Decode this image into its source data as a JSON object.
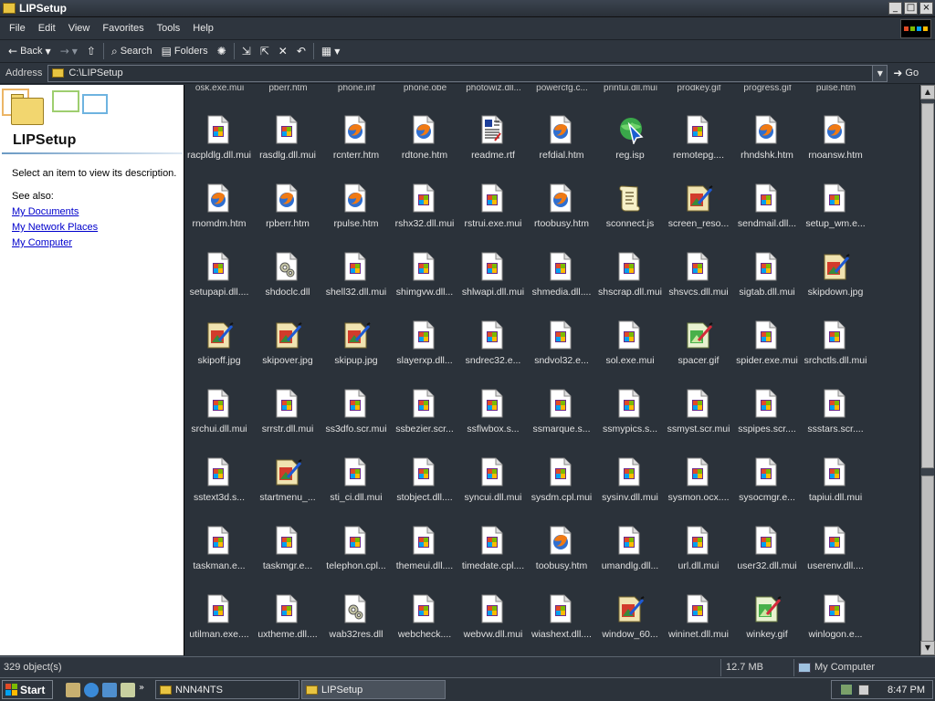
{
  "window": {
    "title": "LIPSetup"
  },
  "window_controls": {
    "minimize": "_",
    "maximize": "□",
    "close": "×"
  },
  "menu": [
    "File",
    "Edit",
    "View",
    "Favorites",
    "Tools",
    "Help"
  ],
  "toolbar": {
    "back": "Back",
    "search": "Search",
    "folders": "Folders"
  },
  "address": {
    "label": "Address",
    "path": "C:\\LIPSetup",
    "go": "Go"
  },
  "left_pane": {
    "title": "LIPSetup",
    "description": "Select an item to view its description.",
    "see_also": "See also:",
    "links": [
      "My Documents",
      "My Network Places",
      "My Computer"
    ]
  },
  "partial_row": [
    "osk.exe.mui",
    "pberr.htm",
    "phone.inf",
    "phone.obe",
    "photowiz.dll...",
    "powercfg.c...",
    "printui.dll.mui",
    "prodkey.gif",
    "progress.gif",
    "pulse.htm"
  ],
  "files": [
    {
      "name": "racpldlg.dll.mui",
      "icon": "mui"
    },
    {
      "name": "rasdlg.dll.mui",
      "icon": "mui"
    },
    {
      "name": "rcnterr.htm",
      "icon": "htm"
    },
    {
      "name": "rdtone.htm",
      "icon": "htm"
    },
    {
      "name": "readme.rtf",
      "icon": "rtf"
    },
    {
      "name": "refdial.htm",
      "icon": "htm"
    },
    {
      "name": "reg.isp",
      "icon": "isp"
    },
    {
      "name": "remotepg....",
      "icon": "mui"
    },
    {
      "name": "rhndshk.htm",
      "icon": "htm"
    },
    {
      "name": "rnoansw.htm",
      "icon": "htm"
    },
    {
      "name": "rnomdm.htm",
      "icon": "htm"
    },
    {
      "name": "rpberr.htm",
      "icon": "htm"
    },
    {
      "name": "rpulse.htm",
      "icon": "htm"
    },
    {
      "name": "rshx32.dll.mui",
      "icon": "mui"
    },
    {
      "name": "rstrui.exe.mui",
      "icon": "mui"
    },
    {
      "name": "rtoobusy.htm",
      "icon": "htm"
    },
    {
      "name": "sconnect.js",
      "icon": "js"
    },
    {
      "name": "screen_reso...",
      "icon": "jpg"
    },
    {
      "name": "sendmail.dll...",
      "icon": "mui"
    },
    {
      "name": "setup_wm.e...",
      "icon": "mui"
    },
    {
      "name": "setupapi.dll....",
      "icon": "mui"
    },
    {
      "name": "shdoclc.dll",
      "icon": "dll"
    },
    {
      "name": "shell32.dll.mui",
      "icon": "mui"
    },
    {
      "name": "shimgvw.dll...",
      "icon": "mui"
    },
    {
      "name": "shlwapi.dll.mui",
      "icon": "mui"
    },
    {
      "name": "shmedia.dll....",
      "icon": "mui"
    },
    {
      "name": "shscrap.dll.mui",
      "icon": "mui"
    },
    {
      "name": "shsvcs.dll.mui",
      "icon": "mui"
    },
    {
      "name": "sigtab.dll.mui",
      "icon": "mui"
    },
    {
      "name": "skipdown.jpg",
      "icon": "jpg"
    },
    {
      "name": "skipoff.jpg",
      "icon": "jpg"
    },
    {
      "name": "skipover.jpg",
      "icon": "jpg"
    },
    {
      "name": "skipup.jpg",
      "icon": "jpg"
    },
    {
      "name": "slayerxp.dll...",
      "icon": "mui"
    },
    {
      "name": "sndrec32.e...",
      "icon": "mui"
    },
    {
      "name": "sndvol32.e...",
      "icon": "mui"
    },
    {
      "name": "sol.exe.mui",
      "icon": "mui"
    },
    {
      "name": "spacer.gif",
      "icon": "gif"
    },
    {
      "name": "spider.exe.mui",
      "icon": "mui"
    },
    {
      "name": "srchctls.dll.mui",
      "icon": "mui"
    },
    {
      "name": "srchui.dll.mui",
      "icon": "mui"
    },
    {
      "name": "srrstr.dll.mui",
      "icon": "mui"
    },
    {
      "name": "ss3dfo.scr.mui",
      "icon": "mui"
    },
    {
      "name": "ssbezier.scr...",
      "icon": "mui"
    },
    {
      "name": "ssflwbox.s...",
      "icon": "mui"
    },
    {
      "name": "ssmarque.s...",
      "icon": "mui"
    },
    {
      "name": "ssmypics.s...",
      "icon": "mui"
    },
    {
      "name": "ssmyst.scr.mui",
      "icon": "mui"
    },
    {
      "name": "sspipes.scr....",
      "icon": "mui"
    },
    {
      "name": "ssstars.scr....",
      "icon": "mui"
    },
    {
      "name": "sstext3d.s...",
      "icon": "mui"
    },
    {
      "name": "startmenu_...",
      "icon": "jpg"
    },
    {
      "name": "sti_ci.dll.mui",
      "icon": "mui"
    },
    {
      "name": "stobject.dll....",
      "icon": "mui"
    },
    {
      "name": "syncui.dll.mui",
      "icon": "mui"
    },
    {
      "name": "sysdm.cpl.mui",
      "icon": "mui"
    },
    {
      "name": "sysinv.dll.mui",
      "icon": "mui"
    },
    {
      "name": "sysmon.ocx....",
      "icon": "mui"
    },
    {
      "name": "sysocmgr.e...",
      "icon": "mui"
    },
    {
      "name": "tapiui.dll.mui",
      "icon": "mui"
    },
    {
      "name": "taskman.e...",
      "icon": "mui"
    },
    {
      "name": "taskmgr.e...",
      "icon": "mui"
    },
    {
      "name": "telephon.cpl...",
      "icon": "mui"
    },
    {
      "name": "themeui.dll....",
      "icon": "mui"
    },
    {
      "name": "timedate.cpl....",
      "icon": "mui"
    },
    {
      "name": "toobusy.htm",
      "icon": "htm"
    },
    {
      "name": "umandlg.dll...",
      "icon": "mui"
    },
    {
      "name": "url.dll.mui",
      "icon": "mui"
    },
    {
      "name": "user32.dll.mui",
      "icon": "mui"
    },
    {
      "name": "userenv.dll....",
      "icon": "mui"
    },
    {
      "name": "utilman.exe....",
      "icon": "mui"
    },
    {
      "name": "uxtheme.dll....",
      "icon": "mui"
    },
    {
      "name": "wab32res.dll",
      "icon": "dll"
    },
    {
      "name": "webcheck....",
      "icon": "mui"
    },
    {
      "name": "webvw.dll.mui",
      "icon": "mui"
    },
    {
      "name": "wiashext.dll....",
      "icon": "mui"
    },
    {
      "name": "window_60...",
      "icon": "jpg"
    },
    {
      "name": "wininet.dll.mui",
      "icon": "mui"
    },
    {
      "name": "winkey.gif",
      "icon": "gif"
    },
    {
      "name": "winlogon.e...",
      "icon": "mui"
    }
  ],
  "status": {
    "objects": "329 object(s)",
    "size": "12.7 MB",
    "location": "My Computer"
  },
  "taskbar": {
    "start": "Start",
    "tasks": [
      "NNN4NTS",
      "LIPSetup"
    ],
    "clock": "8:47 PM"
  }
}
